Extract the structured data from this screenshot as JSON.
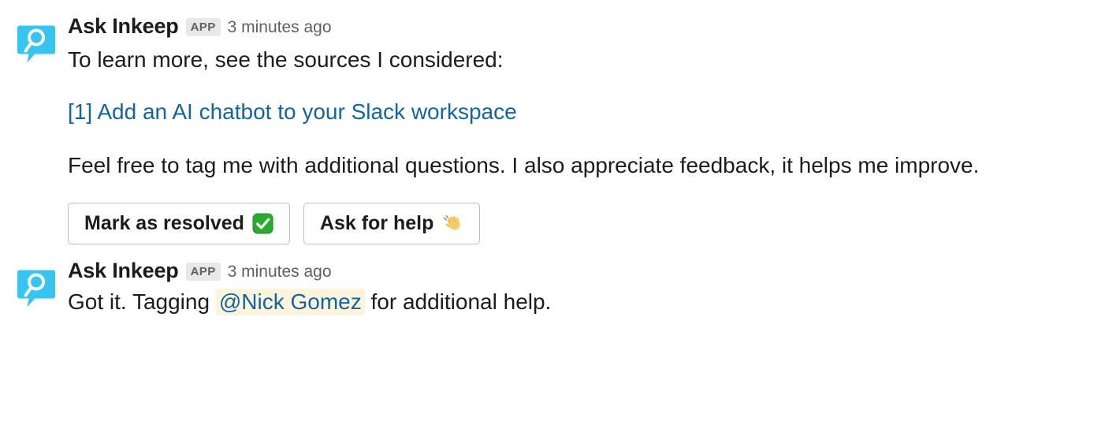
{
  "app": {
    "accent_blue": "#1264a3",
    "avatar_cyan": "#36c5f0",
    "mention_highlight": "#fdf4dc",
    "text_color": "#1d1c1d",
    "meta_color": "#616061",
    "badge_bg": "#e8e8e8"
  },
  "messages": [
    {
      "avatar_icon": "inkeep-speech-bubble-search-icon",
      "sender": "Ask Inkeep",
      "badge": "APP",
      "timestamp": "3 minutes ago",
      "intro_text": "To learn more, see the sources I considered:",
      "source": {
        "marker": "[1]",
        "title": "Add an AI chatbot to your Slack workspace",
        "full_text": "[1] Add an AI chatbot to your Slack workspace"
      },
      "feedback_text": "Feel free to tag me with additional questions. I also appreciate feedback, it helps me improve.",
      "buttons": [
        {
          "label": "Mark as resolved",
          "emoji": "✅",
          "emoji_name": "white-check-mark-emoji"
        },
        {
          "label": "Ask for help",
          "emoji": "👋",
          "emoji_name": "waving-hand-emoji"
        }
      ]
    },
    {
      "avatar_icon": "inkeep-speech-bubble-search-icon",
      "sender": "Ask Inkeep",
      "badge": "APP",
      "timestamp": "3 minutes ago",
      "tagging": {
        "prefix": "Got it. Tagging ",
        "mention": "@Nick Gomez",
        "suffix": " for additional help.",
        "full_text": "Got it. Tagging @Nick Gomez for additional help."
      }
    }
  ]
}
